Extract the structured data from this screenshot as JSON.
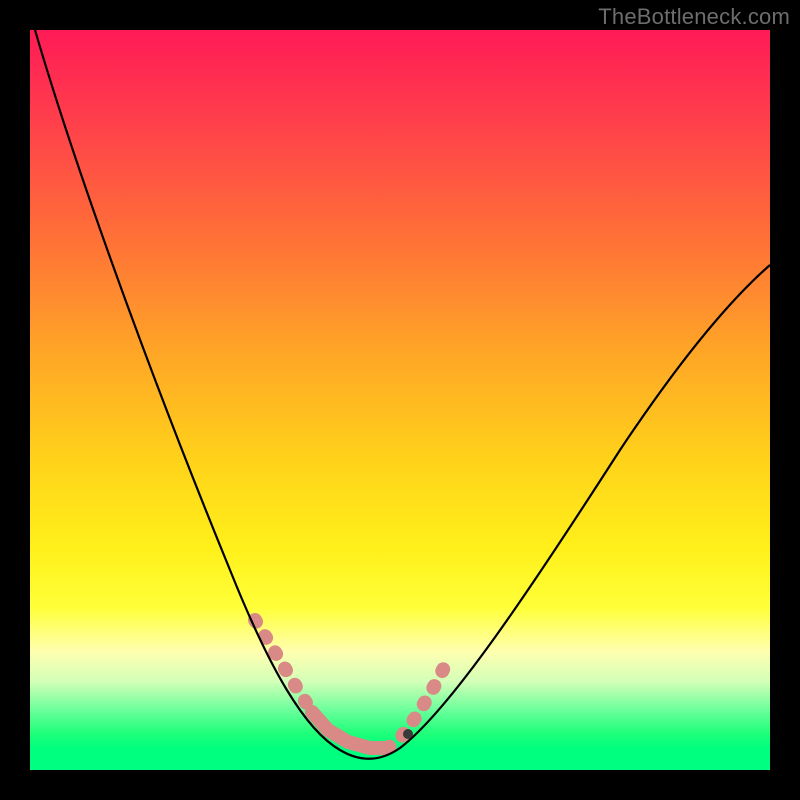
{
  "watermark": "TheBottleneck.com",
  "chart_data": {
    "type": "line",
    "title": "",
    "xlabel": "",
    "ylabel": "",
    "xlim": [
      0,
      100
    ],
    "ylim": [
      0,
      100
    ],
    "series": [
      {
        "name": "curve",
        "x": [
          0,
          5,
          10,
          15,
          20,
          25,
          30,
          33,
          36,
          38,
          40,
          42,
          44,
          46,
          50,
          55,
          60,
          65,
          70,
          75,
          80,
          85,
          90,
          95,
          100
        ],
        "y": [
          100,
          88,
          76,
          64,
          52,
          40,
          28,
          20,
          12,
          8,
          5,
          3,
          2,
          2,
          3,
          7,
          14,
          22,
          31,
          40,
          48,
          55,
          61,
          66,
          70
        ]
      }
    ],
    "highlight": {
      "left_descent": {
        "x_start": 31,
        "x_end": 38
      },
      "trough": {
        "x_start": 38,
        "x_end": 46
      },
      "right_ascent": {
        "x_start": 46,
        "x_end": 53
      }
    },
    "marker": {
      "x": 50,
      "y": 4
    }
  }
}
